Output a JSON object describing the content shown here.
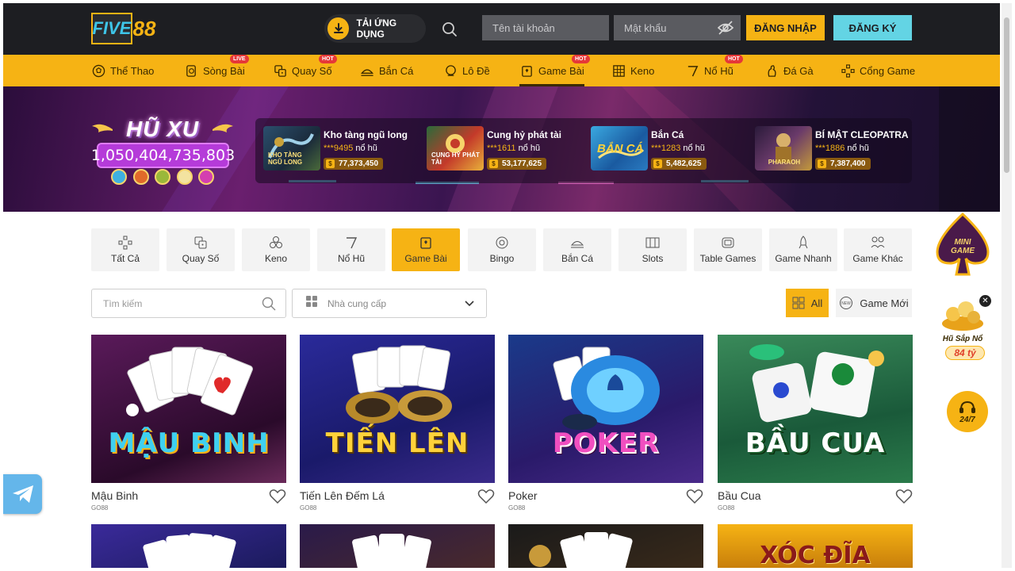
{
  "header": {
    "logo_five": "FIVE",
    "logo_88": "88",
    "app_button": "TẢI ỨNG DỤNG",
    "username_placeholder": "Tên tài khoản",
    "password_placeholder": "Mật khẩu",
    "login_label": "ĐĂNG NHẬP",
    "register_label": "ĐĂNG KÝ"
  },
  "nav": {
    "items": [
      {
        "label": "Thể Thao",
        "icon": "soccer-ball-icon",
        "badge": ""
      },
      {
        "label": "Sòng Bài",
        "icon": "chip-icon",
        "badge": "LIVE"
      },
      {
        "label": "Quay Số",
        "icon": "dice-icon",
        "badge": "HOT"
      },
      {
        "label": "Bắn Cá",
        "icon": "fish-icon",
        "badge": ""
      },
      {
        "label": "Lô Đề",
        "icon": "lottery-ball-icon",
        "badge": ""
      },
      {
        "label": "Game Bài",
        "icon": "card-icon",
        "badge": "HOT"
      },
      {
        "label": "Keno",
        "icon": "keno-icon",
        "badge": ""
      },
      {
        "label": "Nổ Hũ",
        "icon": "slot-icon",
        "badge": "HOT"
      },
      {
        "label": "Đá Gà",
        "icon": "rooster-icon",
        "badge": ""
      },
      {
        "label": "Cổng Game",
        "icon": "gamepad-icon",
        "badge": ""
      }
    ]
  },
  "banner": {
    "title": "HŨ XU",
    "amount": "1,050,404,735,803",
    "jackpots": [
      {
        "name": "Kho tàng ngũ long",
        "user": "***9495",
        "suffix": "nổ hũ",
        "amount": "77,373,450",
        "thumb_text": "KHO TÀNG NGŨ LONG"
      },
      {
        "name": "Cung hỷ phát tài",
        "user": "***1611",
        "suffix": "nổ hũ",
        "amount": "53,177,625",
        "thumb_text": "CUNG HỶ PHÁT TÀI"
      },
      {
        "name": "Bắn Cá",
        "user": "***1283",
        "suffix": "nổ hũ",
        "amount": "5,482,625",
        "thumb_text": "BẮN CÁ"
      },
      {
        "name": "BÍ MẬT CLEOPATRA",
        "user": "***1886",
        "suffix": "nổ hũ",
        "amount": "7,387,400",
        "thumb_text": "PHARAOH"
      }
    ]
  },
  "categories": [
    {
      "label": "Tất Cả",
      "icon": "all-games-icon"
    },
    {
      "label": "Quay Số",
      "icon": "dice-icon"
    },
    {
      "label": "Keno",
      "icon": "keno-balls-icon"
    },
    {
      "label": "Nổ Hũ",
      "icon": "slot-seven-icon"
    },
    {
      "label": "Game Bài",
      "icon": "card-icon"
    },
    {
      "label": "Bingo",
      "icon": "bingo-icon"
    },
    {
      "label": "Bắn Cá",
      "icon": "fish-icon"
    },
    {
      "label": "Slots",
      "icon": "slot-machine-icon"
    },
    {
      "label": "Table Games",
      "icon": "table-icon"
    },
    {
      "label": "Game Nhanh",
      "icon": "rocket-icon"
    },
    {
      "label": "Game Khác",
      "icon": "more-games-icon"
    }
  ],
  "filters": {
    "search_placeholder": "Tìm kiếm",
    "provider_label": "Nhà cung cấp",
    "all_label": "All",
    "new_label": "Game Mới"
  },
  "games": [
    {
      "title": "Mậu Binh",
      "provider": "GO88",
      "thumb_text": "MẬU BINH"
    },
    {
      "title": "Tiến Lên Đếm Lá",
      "provider": "GO88",
      "thumb_text": "TIẾN LÊN"
    },
    {
      "title": "Poker",
      "provider": "GO88",
      "thumb_text": "POKER"
    },
    {
      "title": "Bầu Cua",
      "provider": "GO88",
      "thumb_text": "BẦU CUA"
    }
  ],
  "games_row2": [
    {
      "thumb_text": ""
    },
    {
      "thumb_text": ""
    },
    {
      "thumb_text": ""
    },
    {
      "thumb_text": "XÓC ĐĨA"
    }
  ],
  "widgets": {
    "mini_game": "MINI GAME",
    "hu_sapno_label": "Hũ Sắp Nổ",
    "hu_sapno_amount": "84 tỷ",
    "support_label": "24/7"
  }
}
